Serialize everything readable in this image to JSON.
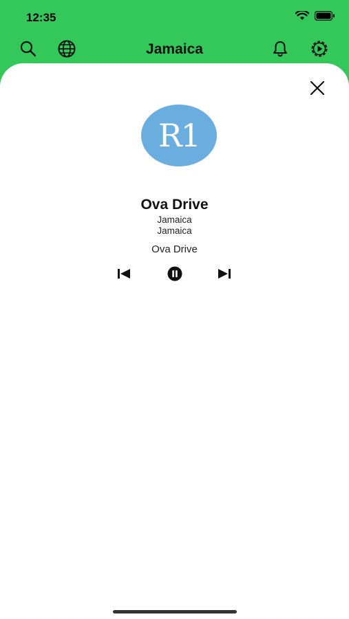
{
  "status_bar": {
    "time": "12:35"
  },
  "nav": {
    "title": "Jamaica",
    "icons": [
      "search-icon",
      "globe-icon",
      "bell-icon",
      "settings-icon"
    ]
  },
  "colors": {
    "header": "#34c759",
    "logo_bg": "#6aaee0"
  },
  "player": {
    "logo_text": "R1",
    "station_name": "Ova Drive",
    "subtitle_1": "Jamaica",
    "subtitle_2": "Jamaica",
    "now_playing": "Ova Drive",
    "controls": [
      "previous-icon",
      "pause-icon",
      "next-icon"
    ]
  }
}
